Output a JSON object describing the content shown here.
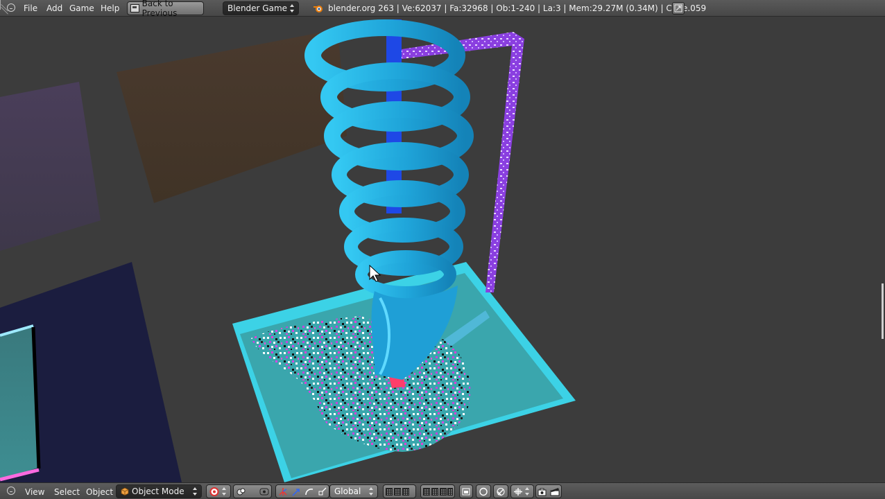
{
  "topbar": {
    "menus": [
      "File",
      "Add",
      "Game",
      "Help"
    ],
    "back_button": "Back to Previous",
    "engine": "Blender Game",
    "stats": "blender.org 263 | Ve:62037 | Fa:32968 | Ob:1-240 | La:3 | Mem:29.27M (0.34M) | Cube.059"
  },
  "bottombar": {
    "menus": [
      "View",
      "Select",
      "Object"
    ],
    "mode": "Object Mode",
    "orientation": "Global"
  },
  "colors": {
    "header_bg": "#4f4f4f",
    "viewport_bg": "#3c3c3c",
    "spiral": "#2bb8e6",
    "base": "#3aa9b3",
    "rail": "#8a3fe0",
    "pole": "#1e48e6"
  }
}
